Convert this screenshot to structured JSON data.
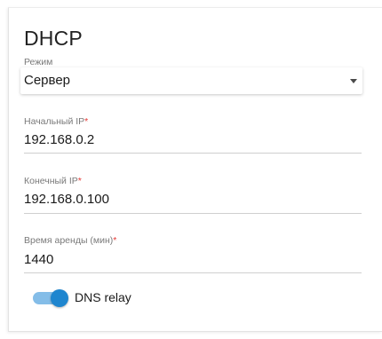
{
  "section": {
    "title": "DHCP"
  },
  "mode": {
    "label": "Режим",
    "value": "Сервер"
  },
  "start_ip": {
    "label": "Начальный IP",
    "required_mark": "*",
    "value": "192.168.0.2"
  },
  "end_ip": {
    "label": "Конечный IP",
    "required_mark": "*",
    "value": "192.168.0.100"
  },
  "lease_time": {
    "label": "Время аренды (мин)",
    "required_mark": "*",
    "value": "1440"
  },
  "dns_relay": {
    "label": "DNS relay",
    "enabled": true
  },
  "colors": {
    "accent": "#1f86cf",
    "toggle_track": "#84bde8",
    "required": "#e53935"
  }
}
